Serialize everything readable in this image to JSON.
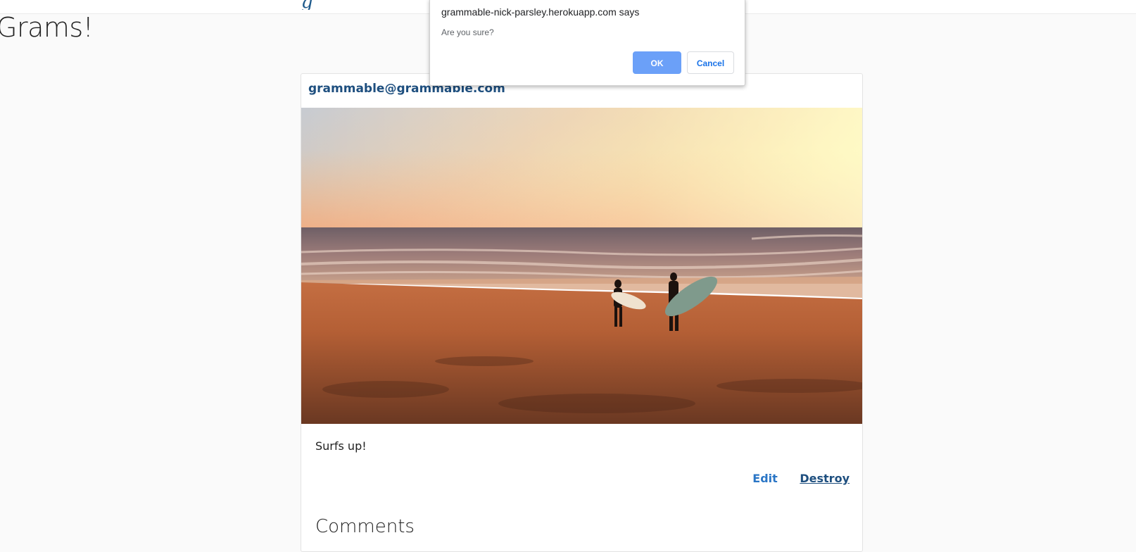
{
  "header": {
    "brand_glyph": "g"
  },
  "page": {
    "title": "Grams!"
  },
  "post": {
    "author": "grammable@grammable.com",
    "image_description": "Two surfers carrying surfboards walking on a beach at sunset",
    "caption": "Surfs up!",
    "edit_label": "Edit",
    "destroy_label": "Destroy",
    "comments_heading": "Comments"
  },
  "dialog": {
    "title": "grammable-nick-parsley.herokuapp.com says",
    "message": "Are you sure?",
    "ok_label": "OK",
    "cancel_label": "Cancel"
  },
  "colors": {
    "link_primary": "#2a76c6",
    "link_dark": "#1e4f7f",
    "ok_button": "#6ba0f8",
    "cancel_text": "#1a73e8"
  }
}
